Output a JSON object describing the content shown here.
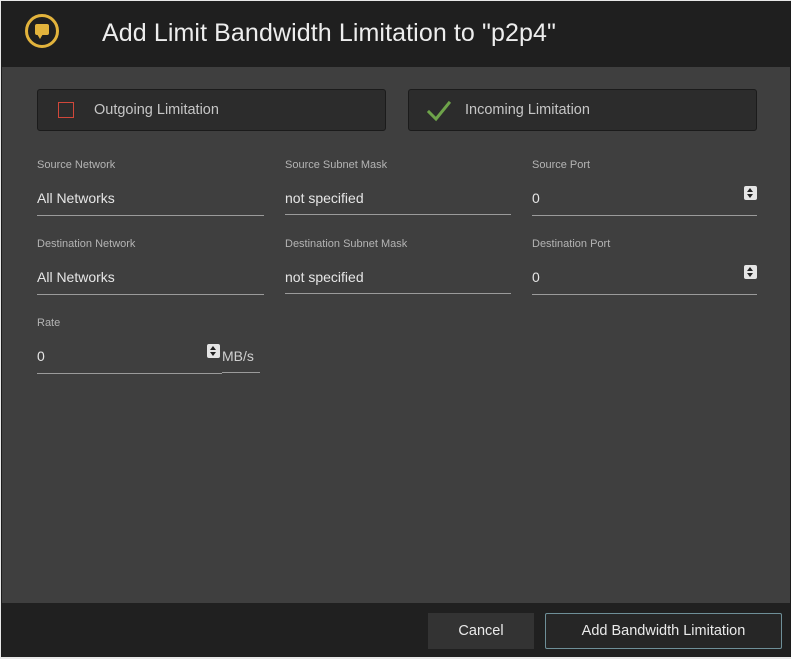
{
  "dialog": {
    "title": "Add Limit Bandwidth Limitation to \"p2p4\"",
    "icon": "speech-bubble-icon"
  },
  "toggles": {
    "outgoing": {
      "label": "Outgoing Limitation",
      "checked": false
    },
    "incoming": {
      "label": "Incoming Limitation",
      "checked": true
    }
  },
  "fields": {
    "source_network": {
      "label": "Source Network",
      "value": "All Networks"
    },
    "source_subnet_mask": {
      "label": "Source Subnet Mask",
      "value": "not specified"
    },
    "source_port": {
      "label": "Source Port",
      "value": "0"
    },
    "destination_network": {
      "label": "Destination Network",
      "value": "All Networks"
    },
    "destination_subnet_mask": {
      "label": "Destination Subnet Mask",
      "value": "not specified"
    },
    "destination_port": {
      "label": "Destination Port",
      "value": "0"
    },
    "rate": {
      "label": "Rate",
      "value": "0",
      "unit": "MB/s"
    }
  },
  "buttons": {
    "cancel": "Cancel",
    "add": "Add Bandwidth Limitation"
  },
  "colors": {
    "accent_icon": "#e2b33c",
    "check_green": "#6ea34a",
    "unchecked_red": "#d1473a",
    "primary_button_border": "#6e8f98"
  }
}
